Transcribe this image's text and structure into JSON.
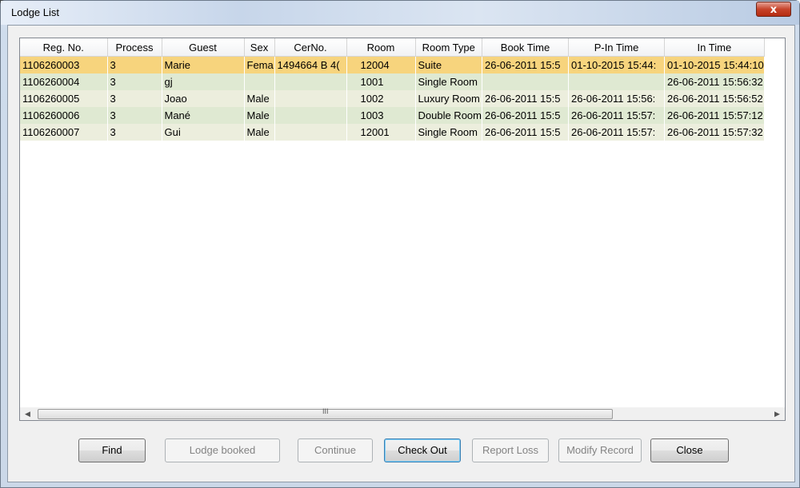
{
  "window": {
    "title": "Lodge List",
    "close_glyph": "x"
  },
  "table": {
    "columns": [
      "Reg. No.",
      "Process",
      "Guest",
      "Sex",
      "CerNo.",
      "Room",
      "Room Type",
      "Book Time",
      "P-In Time",
      "In Time"
    ],
    "rows": [
      [
        "1106260003",
        "3",
        "Marie",
        "Fema",
        "1494664 B 4(",
        "12004",
        "Suite",
        "26-06-2011 15:5",
        "01-10-2015 15:44:",
        "01-10-2015 15:44:10"
      ],
      [
        "1106260004",
        "3",
        "gj",
        "",
        "",
        "1001",
        "Single Room",
        "",
        "",
        "26-06-2011 15:56:32"
      ],
      [
        "1106260005",
        "3",
        "Joao",
        "Male",
        "",
        "1002",
        "Luxury Room",
        "26-06-2011 15:5",
        "26-06-2011 15:56:",
        "26-06-2011 15:56:52"
      ],
      [
        "1106260006",
        "3",
        "Mané",
        "Male",
        "",
        "1003",
        "Double Room",
        "26-06-2011 15:5",
        "26-06-2011 15:57:",
        "26-06-2011 15:57:12"
      ],
      [
        "1106260007",
        "3",
        "Gui",
        "Male",
        "",
        "12001",
        "Single Room",
        "26-06-2011 15:5",
        "26-06-2011 15:57:",
        "26-06-2011 15:57:32"
      ]
    ],
    "selected_row": 0
  },
  "scrollbar": {
    "left_arrow": "◀",
    "right_arrow": "▶",
    "grip": "III"
  },
  "buttons": {
    "find": "Find",
    "lodge_booked": "Lodge booked",
    "continue": "Continue",
    "check_out": "Check Out",
    "report_loss": "Report Loss",
    "modify_record": "Modify Record",
    "close": "Close"
  }
}
